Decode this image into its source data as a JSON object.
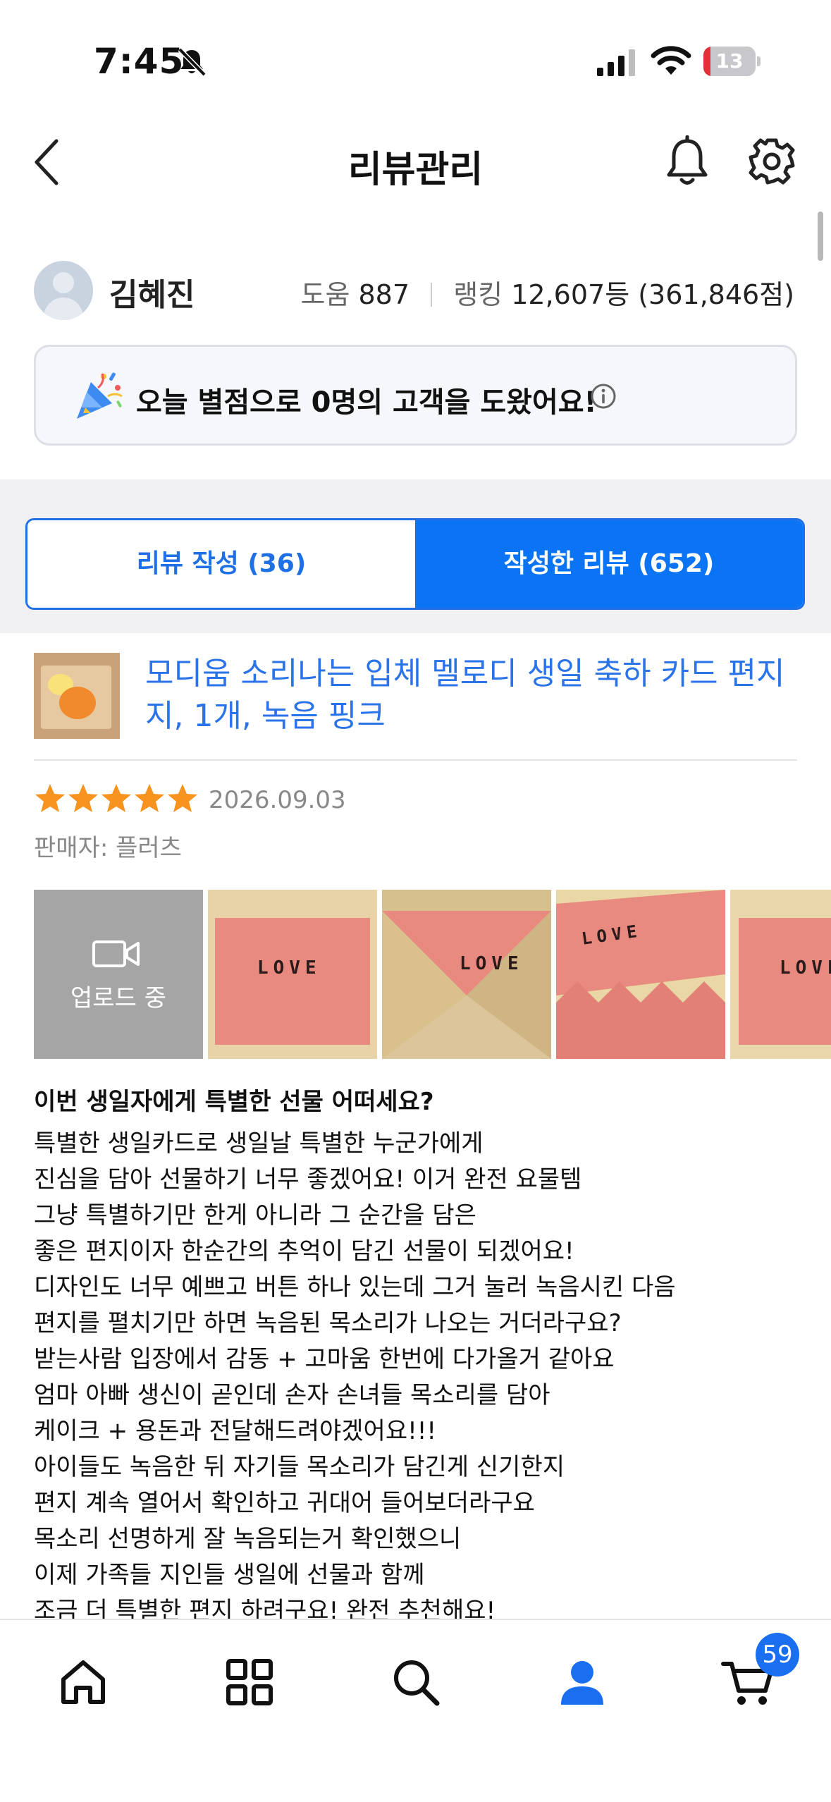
{
  "status_bar": {
    "time": "7:45",
    "battery": "13",
    "battery_level": 0.13
  },
  "header": {
    "title": "리뷰관리"
  },
  "profile": {
    "name": "김혜진",
    "help_label": "도움",
    "help_count": "887",
    "rank_label": "랭킹",
    "rank_value": "12,607등 (361,846점)"
  },
  "banner": {
    "prefix": "오늘 별점으로 ",
    "count": "0명",
    "suffix": "의 고객을 도왔어요!"
  },
  "tabs": [
    {
      "label": "리뷰 작성 (36)",
      "active": false
    },
    {
      "label": "작성한 리뷰 (652)",
      "active": true
    }
  ],
  "product": {
    "title": "모디움 소리나는 입체 멜로디 생일 축하 카드 편지지, 1개, 녹음 핑크"
  },
  "review": {
    "rating": 5,
    "date": "2026.09.03",
    "seller": "판매자: 플러츠",
    "upload_label": "업로드 중",
    "photo_text": "LOVE",
    "heading": "이번 생일자에게 특별한 선물 어떠세요?",
    "body_lines": [
      "특별한 생일카드로 생일날 특별한 누군가에게",
      "진심을 담아 선물하기 너무 좋겠어요! 이거 완전 요물템",
      "그냥 특별하기만 한게 아니라 그 순간을 담은",
      "좋은 편지이자 한순간의 추억이 담긴 선물이 되겠어요!",
      "디자인도 너무 예쁘고 버튼 하나 있는데 그거 눌러 녹음시킨 다음",
      "편지를 펼치기만 하면 녹음된 목소리가 나오는 거더라구요?",
      "받는사람 입장에서 감동 + 고마움 한번에 다가올거 같아요",
      "엄마 아빠 생신이 곧인데 손자 손녀들 목소리를 담아",
      "케이크 + 용돈과 전달해드려야겠어요!!!",
      "아이들도 녹음한 뒤 자기들 목소리가 담긴게 신기한지",
      "편지 계속 열어서 확인하고 귀대어 들어보더라구요",
      "목소리 선명하게 잘 녹음되는거 확인했으니",
      "이제 가족들 지인들 생일에 선물과 함께",
      "조금 더 특별한 편지 하려구요! 완전 추천해요!"
    ]
  },
  "bottom_nav": {
    "cart_badge": "59"
  },
  "colors": {
    "accent": "#0a74f5",
    "link": "#2a73e8",
    "star": "#f7931e"
  }
}
